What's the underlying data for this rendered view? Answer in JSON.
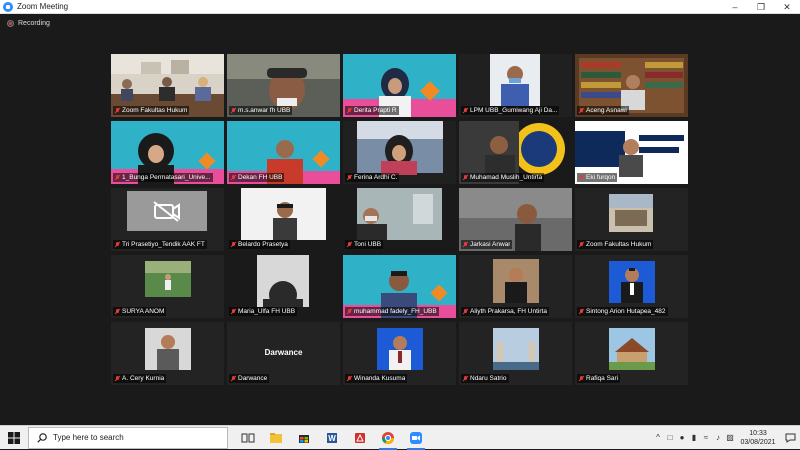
{
  "window": {
    "title": "Zoom Meeting"
  },
  "recording": {
    "label": "Recording"
  },
  "participants": [
    {
      "name": "Zoom Fakultas Hukum",
      "muted": true
    },
    {
      "name": "m.s.anwar fh UBB",
      "muted": true
    },
    {
      "name": "Derita Prapti R",
      "muted": true
    },
    {
      "name": "LPM UBB_Gumiwang Aji Da...",
      "muted": true
    },
    {
      "name": "Aceng Asnawi",
      "muted": true
    },
    {
      "name": "1_Bunga Permatasari_Unive...",
      "muted": true
    },
    {
      "name": "Dekan FH UBB",
      "muted": true
    },
    {
      "name": "Ferina Ardhi C.",
      "muted": true
    },
    {
      "name": "Muhamad Muslih_Untirta",
      "muted": true
    },
    {
      "name": "Eki furqon",
      "muted": true
    },
    {
      "name": "Tri Prasetiyo_Tendik AAK FT",
      "muted": true
    },
    {
      "name": "Belardo Prasetya",
      "muted": true
    },
    {
      "name": "Toni UBB",
      "muted": true
    },
    {
      "name": "Jarkasi Anwar",
      "muted": true
    },
    {
      "name": "Zoom Fakultas Hukum",
      "muted": true
    },
    {
      "name": "SURYA ANOM",
      "muted": true
    },
    {
      "name": "Maria_Ulfa FH UBB",
      "muted": true
    },
    {
      "name": "muhammad fadely_FH_UBB",
      "muted": true
    },
    {
      "name": "Aliyth Prakarsa, FH Untirta",
      "muted": true
    },
    {
      "name": "Sintong Arion Hutapea_482",
      "muted": true
    },
    {
      "name": "A. Cery Kurnia",
      "muted": true
    },
    {
      "name": "Darwance",
      "muted": true
    },
    {
      "name": "Winanda Kusuma",
      "muted": true
    },
    {
      "name": "Ndaru Satrio",
      "muted": true
    },
    {
      "name": "Rafiqa Sari",
      "muted": true
    }
  ],
  "darwance_placeholder": "Darwance",
  "taskbar": {
    "search_placeholder": "Type here to search",
    "time": "10:33",
    "date": "03/08/2021"
  },
  "colors": {
    "active_speaker": "#c6e031",
    "muted_icon": "#e23b3b",
    "zoom_blue": "#2d8cff"
  }
}
